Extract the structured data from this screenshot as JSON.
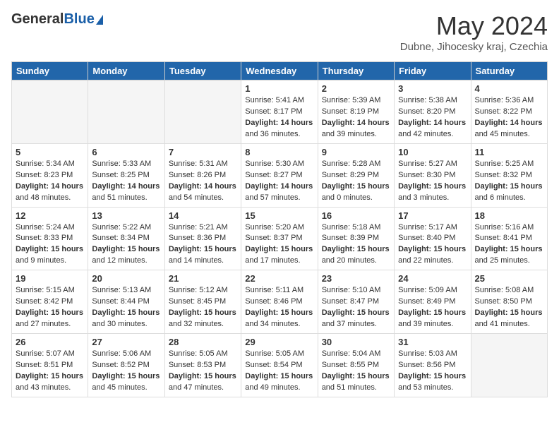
{
  "header": {
    "logo_general": "General",
    "logo_blue": "Blue",
    "title": "May 2024",
    "location": "Dubne, Jihocesky kraj, Czechia"
  },
  "days_of_week": [
    "Sunday",
    "Monday",
    "Tuesday",
    "Wednesday",
    "Thursday",
    "Friday",
    "Saturday"
  ],
  "weeks": [
    [
      {
        "day": "",
        "info": ""
      },
      {
        "day": "",
        "info": ""
      },
      {
        "day": "",
        "info": ""
      },
      {
        "day": "1",
        "info": "Sunrise: 5:41 AM\nSunset: 8:17 PM\nDaylight: 14 hours\nand 36 minutes."
      },
      {
        "day": "2",
        "info": "Sunrise: 5:39 AM\nSunset: 8:19 PM\nDaylight: 14 hours\nand 39 minutes."
      },
      {
        "day": "3",
        "info": "Sunrise: 5:38 AM\nSunset: 8:20 PM\nDaylight: 14 hours\nand 42 minutes."
      },
      {
        "day": "4",
        "info": "Sunrise: 5:36 AM\nSunset: 8:22 PM\nDaylight: 14 hours\nand 45 minutes."
      }
    ],
    [
      {
        "day": "5",
        "info": "Sunrise: 5:34 AM\nSunset: 8:23 PM\nDaylight: 14 hours\nand 48 minutes."
      },
      {
        "day": "6",
        "info": "Sunrise: 5:33 AM\nSunset: 8:25 PM\nDaylight: 14 hours\nand 51 minutes."
      },
      {
        "day": "7",
        "info": "Sunrise: 5:31 AM\nSunset: 8:26 PM\nDaylight: 14 hours\nand 54 minutes."
      },
      {
        "day": "8",
        "info": "Sunrise: 5:30 AM\nSunset: 8:27 PM\nDaylight: 14 hours\nand 57 minutes."
      },
      {
        "day": "9",
        "info": "Sunrise: 5:28 AM\nSunset: 8:29 PM\nDaylight: 15 hours\nand 0 minutes."
      },
      {
        "day": "10",
        "info": "Sunrise: 5:27 AM\nSunset: 8:30 PM\nDaylight: 15 hours\nand 3 minutes."
      },
      {
        "day": "11",
        "info": "Sunrise: 5:25 AM\nSunset: 8:32 PM\nDaylight: 15 hours\nand 6 minutes."
      }
    ],
    [
      {
        "day": "12",
        "info": "Sunrise: 5:24 AM\nSunset: 8:33 PM\nDaylight: 15 hours\nand 9 minutes."
      },
      {
        "day": "13",
        "info": "Sunrise: 5:22 AM\nSunset: 8:34 PM\nDaylight: 15 hours\nand 12 minutes."
      },
      {
        "day": "14",
        "info": "Sunrise: 5:21 AM\nSunset: 8:36 PM\nDaylight: 15 hours\nand 14 minutes."
      },
      {
        "day": "15",
        "info": "Sunrise: 5:20 AM\nSunset: 8:37 PM\nDaylight: 15 hours\nand 17 minutes."
      },
      {
        "day": "16",
        "info": "Sunrise: 5:18 AM\nSunset: 8:39 PM\nDaylight: 15 hours\nand 20 minutes."
      },
      {
        "day": "17",
        "info": "Sunrise: 5:17 AM\nSunset: 8:40 PM\nDaylight: 15 hours\nand 22 minutes."
      },
      {
        "day": "18",
        "info": "Sunrise: 5:16 AM\nSunset: 8:41 PM\nDaylight: 15 hours\nand 25 minutes."
      }
    ],
    [
      {
        "day": "19",
        "info": "Sunrise: 5:15 AM\nSunset: 8:42 PM\nDaylight: 15 hours\nand 27 minutes."
      },
      {
        "day": "20",
        "info": "Sunrise: 5:13 AM\nSunset: 8:44 PM\nDaylight: 15 hours\nand 30 minutes."
      },
      {
        "day": "21",
        "info": "Sunrise: 5:12 AM\nSunset: 8:45 PM\nDaylight: 15 hours\nand 32 minutes."
      },
      {
        "day": "22",
        "info": "Sunrise: 5:11 AM\nSunset: 8:46 PM\nDaylight: 15 hours\nand 34 minutes."
      },
      {
        "day": "23",
        "info": "Sunrise: 5:10 AM\nSunset: 8:47 PM\nDaylight: 15 hours\nand 37 minutes."
      },
      {
        "day": "24",
        "info": "Sunrise: 5:09 AM\nSunset: 8:49 PM\nDaylight: 15 hours\nand 39 minutes."
      },
      {
        "day": "25",
        "info": "Sunrise: 5:08 AM\nSunset: 8:50 PM\nDaylight: 15 hours\nand 41 minutes."
      }
    ],
    [
      {
        "day": "26",
        "info": "Sunrise: 5:07 AM\nSunset: 8:51 PM\nDaylight: 15 hours\nand 43 minutes."
      },
      {
        "day": "27",
        "info": "Sunrise: 5:06 AM\nSunset: 8:52 PM\nDaylight: 15 hours\nand 45 minutes."
      },
      {
        "day": "28",
        "info": "Sunrise: 5:05 AM\nSunset: 8:53 PM\nDaylight: 15 hours\nand 47 minutes."
      },
      {
        "day": "29",
        "info": "Sunrise: 5:05 AM\nSunset: 8:54 PM\nDaylight: 15 hours\nand 49 minutes."
      },
      {
        "day": "30",
        "info": "Sunrise: 5:04 AM\nSunset: 8:55 PM\nDaylight: 15 hours\nand 51 minutes."
      },
      {
        "day": "31",
        "info": "Sunrise: 5:03 AM\nSunset: 8:56 PM\nDaylight: 15 hours\nand 53 minutes."
      },
      {
        "day": "",
        "info": ""
      }
    ]
  ]
}
